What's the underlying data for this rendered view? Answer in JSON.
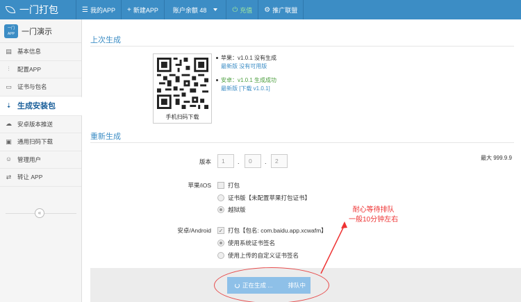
{
  "topbar": {
    "brand": "一门打包",
    "my_app": "我的APP",
    "new_app": "新建APP",
    "balance": "账户余额 48",
    "recharge": "充值",
    "affiliate": "推广联盟",
    "colors": {
      "bar": "#3c8dc5",
      "recharge": "#9fe89f"
    }
  },
  "sidebar": {
    "app_logo_top": "一门",
    "app_logo_bottom": "APP",
    "app_name": "一门演示",
    "items": [
      {
        "label": "基本信息",
        "icon": "document-icon"
      },
      {
        "label": "配置APP",
        "icon": "sliders-icon"
      },
      {
        "label": "证书与包名",
        "icon": "certificate-icon"
      },
      {
        "label": "生成安装包",
        "icon": "sort-download-icon",
        "active": true
      },
      {
        "label": "安卓版本推送",
        "icon": "cloud-icon"
      },
      {
        "label": "通用扫码下载",
        "icon": "scan-icon"
      },
      {
        "label": "管理用户",
        "icon": "user-icon"
      },
      {
        "label": "转让 APP",
        "icon": "transfer-icon"
      }
    ],
    "collapse_glyph": "«"
  },
  "last_build": {
    "title": "上次生成",
    "qr_caption": "手机扫码下载",
    "apple_status": "苹果：v1.0.1 没有生成",
    "apple_latest": "最新版 没有可用版",
    "android_status": "安卓：v1.0.1 生成成功",
    "android_latest_prefix": "最新版 ",
    "android_download": "[下载 v1.0.1]"
  },
  "rebuild": {
    "title": "重新生成",
    "version_label": "版本",
    "version_placeholders": [
      "1",
      "0",
      "2"
    ],
    "version_sep": ".",
    "max_version": "最大 999.9.9",
    "ios_label": "苹果/iOS",
    "ios_pack": "打包",
    "ios_cert": "证书版【未配置苹果打包证书】",
    "ios_jailbreak": "越狱版",
    "android_label": "安卓/Android",
    "android_pack": "打包【包名: com.baidu.app.xcwafm】",
    "android_sys_cert": "使用系统证书签名",
    "android_custom_cert": "使用上传的自定义证书签名",
    "generating": "正在生成 ...",
    "queued": "排队中"
  },
  "annotation": {
    "line1": "耐心等待排队",
    "line2": "一般10分钟左右",
    "color": "#e33333"
  }
}
